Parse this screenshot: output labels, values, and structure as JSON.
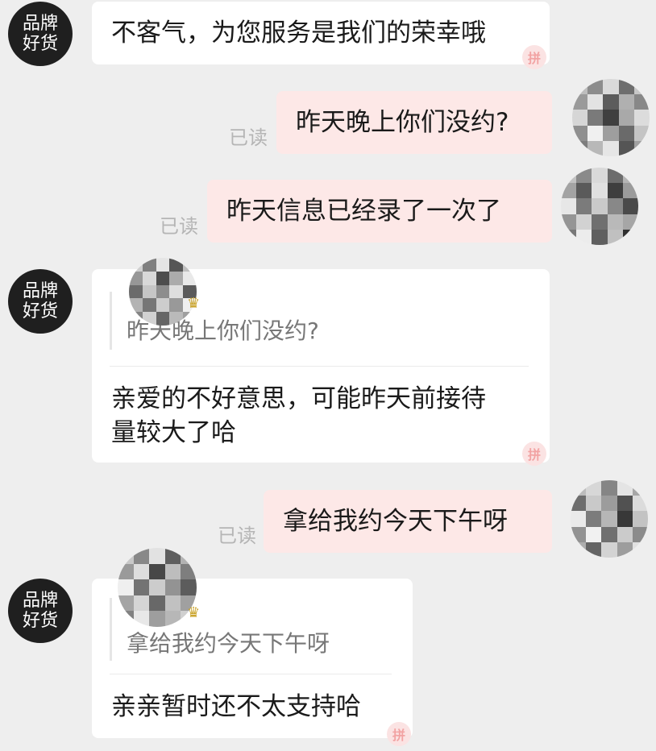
{
  "shop": {
    "name_line1": "品牌",
    "name_line2": "好货"
  },
  "read_label": "已读",
  "stamp_glyph": "拼",
  "crown_glyph": "♛",
  "messages": [
    {
      "id": 1,
      "from": "shop",
      "text": "不客气，为您服务是我们的荣幸哦"
    },
    {
      "id": 2,
      "from": "user",
      "text": "昨天晚上你们没约?",
      "status": "已读"
    },
    {
      "id": 3,
      "from": "user",
      "text": "昨天信息已经录了一次了",
      "status": "已读"
    },
    {
      "id": 4,
      "from": "shop",
      "quote": "昨天晚上你们没约?",
      "text_line1": "亲爱的不好意思，可能昨天前接待",
      "text_line2": "量较大了哈"
    },
    {
      "id": 5,
      "from": "user",
      "text": "拿给我约今天下午呀",
      "status": "已读"
    },
    {
      "id": 6,
      "from": "shop",
      "quote": "拿给我约今天下午呀",
      "text": "亲亲暂时还不太支持哈"
    }
  ],
  "colors": {
    "background": "#eeeeee",
    "incoming_bubble": "#ffffff",
    "outgoing_bubble": "#fde8e7",
    "shop_avatar": "#1f1f1f",
    "read_receipt": "#b5b5b5"
  }
}
